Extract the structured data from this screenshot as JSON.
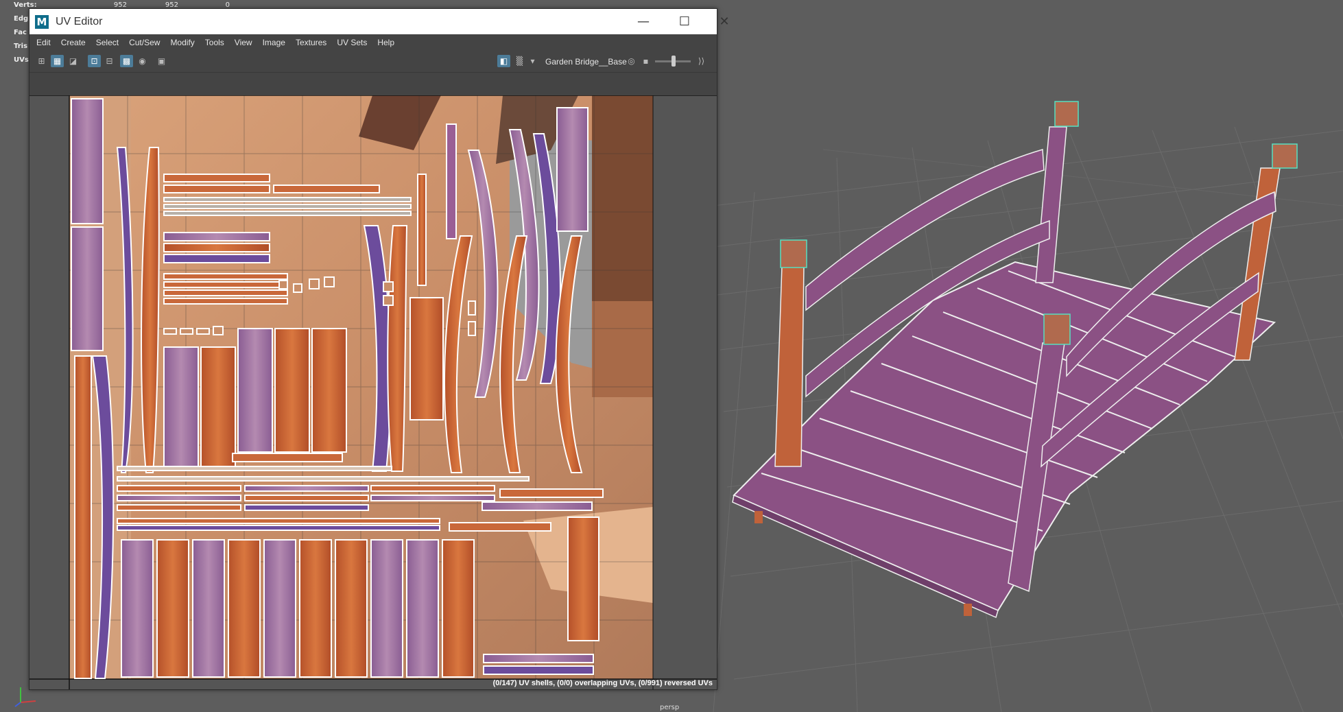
{
  "hud": {
    "rows": [
      {
        "label": "Verts:",
        "values": [
          "952",
          "952",
          "0"
        ]
      },
      {
        "label": "Edg",
        "values": [
          "",
          "",
          ""
        ]
      },
      {
        "label": "Fac",
        "values": [
          "",
          "",
          ""
        ]
      },
      {
        "label": "Tris",
        "values": [
          "",
          "",
          ""
        ]
      },
      {
        "label": "UVs",
        "values": [
          "",
          "",
          ""
        ]
      }
    ]
  },
  "viewport": {
    "camera": "persp"
  },
  "uv_editor": {
    "title": "UV Editor",
    "app_icon": "M",
    "window_buttons": {
      "minimize": "—",
      "maximize": "☐",
      "close": "✕"
    },
    "menus": [
      "Edit",
      "Create",
      "Select",
      "Cut/Sew",
      "Modify",
      "Tools",
      "View",
      "Image",
      "Textures",
      "UV Sets",
      "Help"
    ],
    "texture_name": "Garden Bridge__Base",
    "status": "(0/147) UV shells, (0/0) overlapping UVs, (0/991) reversed UVs"
  },
  "colors": {
    "viewport_bg": "#5d5d5d",
    "wood_orange": "#c9683a",
    "wood_purple": "#9a5f95",
    "uv_outline": "#ffffff",
    "selection_cyan": "#56e0c0"
  }
}
